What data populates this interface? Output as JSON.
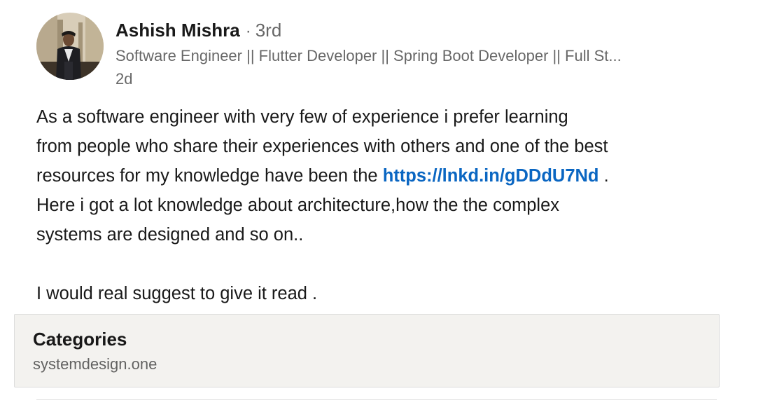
{
  "author": {
    "name": "Ashish Mishra",
    "separator": "·",
    "degree": "3rd",
    "headline": "Software Engineer || Flutter Developer || Spring Boot Developer || Full St...",
    "timestamp": "2d",
    "avatar_icon": "profile-photo"
  },
  "post": {
    "line1": "As a software engineer  with very few of experience  i prefer learning",
    "line2": "from people who share their experiences with others and one of the best",
    "line3_before": "resources  for my knowledge  have been the ",
    "link_text": "https://lnkd.in/gDDdU7Nd",
    "line3_after": " .",
    "line4": "Here  i got a lot knowledge  about architecture,how the the complex",
    "line5": "systems are designed and so on..",
    "line7": "I would real suggest to give it read ."
  },
  "categories": {
    "title": "Categories",
    "value": "systemdesign.one"
  },
  "colors": {
    "link": "#0a66c2",
    "card_background": "#f3f2ef",
    "secondary_text": "#666666"
  }
}
